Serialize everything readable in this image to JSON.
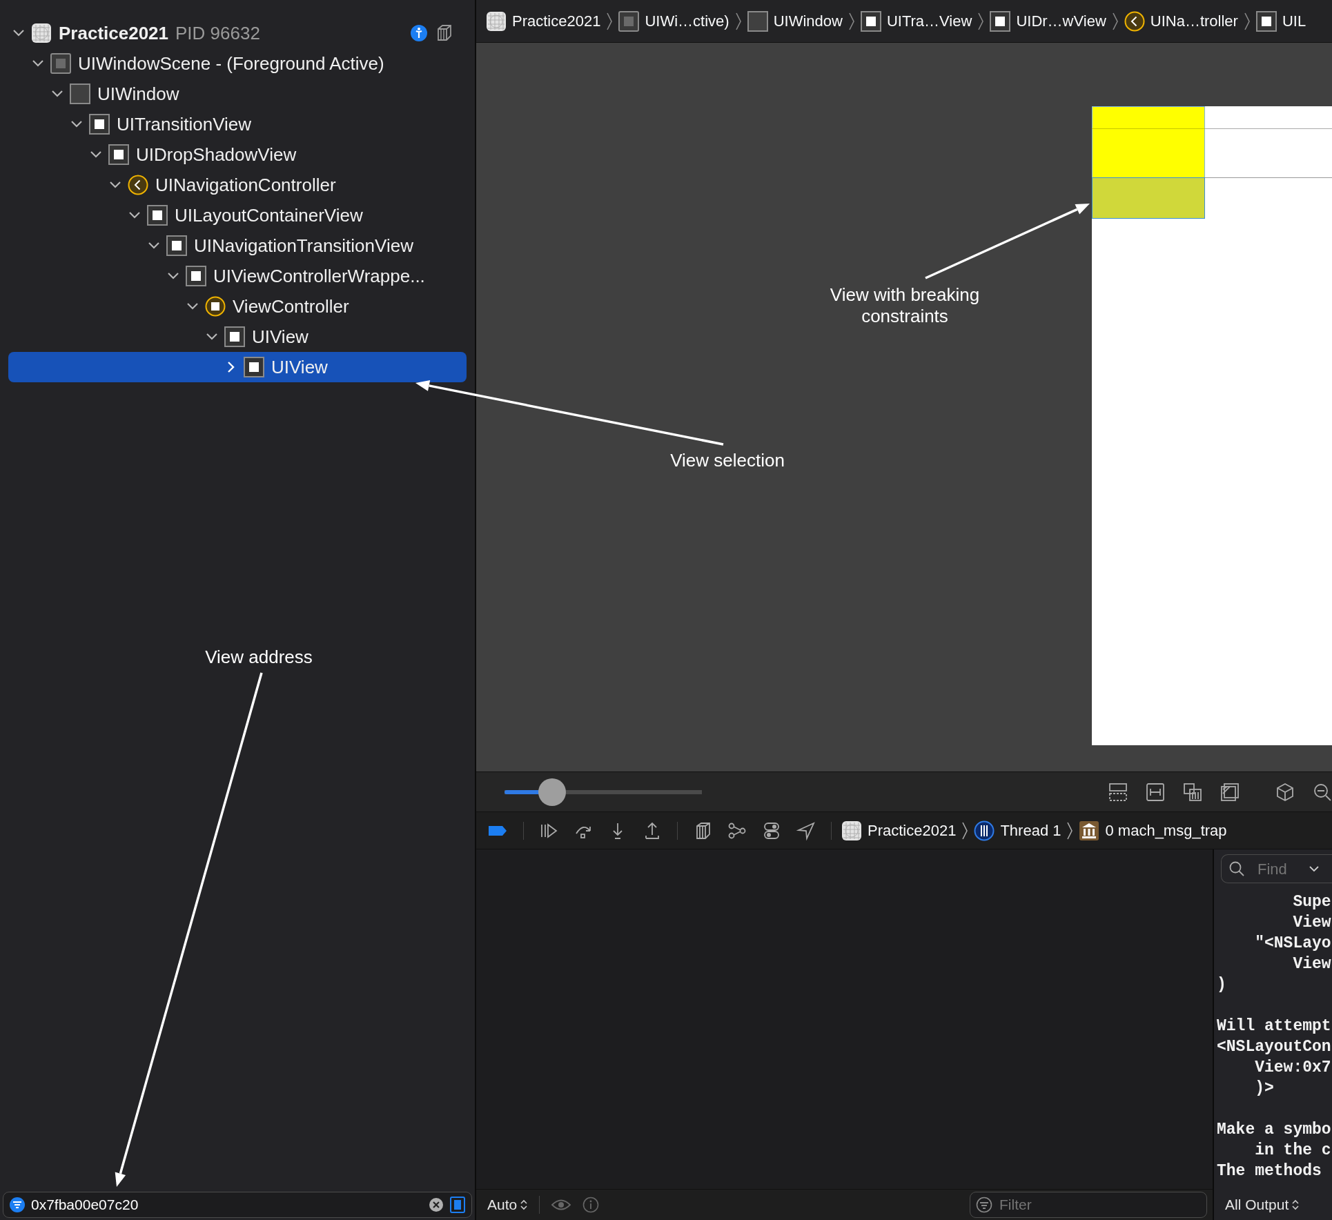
{
  "breadcrumb": [
    {
      "label": "Practice2021",
      "kind": "app"
    },
    {
      "label": "UIWi…ctive)",
      "kind": "scene"
    },
    {
      "label": "UIWindow",
      "kind": "window"
    },
    {
      "label": "UITra…View",
      "kind": "view"
    },
    {
      "label": "UIDr…wView",
      "kind": "view"
    },
    {
      "label": "UINa…troller",
      "kind": "nav"
    },
    {
      "label": "UIL",
      "kind": "view"
    }
  ],
  "tree": [
    {
      "label": "Practice2021",
      "detail": "PID 96632",
      "kind": "app",
      "expanded": true,
      "selected": false,
      "children": [
        {
          "label": "UIWindowScene - (Foreground Active)",
          "kind": "scene",
          "expanded": true,
          "selected": false,
          "children": [
            {
              "label": "UIWindow",
              "kind": "window",
              "expanded": true,
              "selected": false,
              "children": [
                {
                  "label": "UITransitionView",
                  "kind": "view",
                  "expanded": true,
                  "selected": false,
                  "children": [
                    {
                      "label": "UIDropShadowView",
                      "kind": "view",
                      "expanded": true,
                      "selected": false,
                      "children": [
                        {
                          "label": "UINavigationController",
                          "kind": "nav",
                          "expanded": true,
                          "selected": false,
                          "children": [
                            {
                              "label": "UILayoutContainerView",
                              "kind": "view",
                              "expanded": true,
                              "selected": false,
                              "children": [
                                {
                                  "label": "UINavigationTransitionView",
                                  "kind": "view",
                                  "expanded": true,
                                  "selected": false,
                                  "children": [
                                    {
                                      "label": "UIViewControllerWrappe...",
                                      "kind": "view",
                                      "expanded": true,
                                      "selected": false,
                                      "children": [
                                        {
                                          "label": "ViewController",
                                          "kind": "vc",
                                          "expanded": true,
                                          "selected": false,
                                          "children": [
                                            {
                                              "label": "UIView",
                                              "kind": "view",
                                              "expanded": true,
                                              "selected": false,
                                              "children": [
                                                {
                                                  "label": "UIView",
                                                  "kind": "view",
                                                  "expanded": false,
                                                  "selected": true
                                                }
                                              ]
                                            }
                                          ]
                                        }
                                      ]
                                    }
                                  ]
                                }
                              ]
                            }
                          ]
                        }
                      ]
                    }
                  ]
                }
              ]
            }
          ]
        }
      ]
    }
  ],
  "canvas": {
    "zoom_slider": {
      "level": 0.24
    }
  },
  "annotations": [
    {
      "text": "View with breaking constraints"
    },
    {
      "text": "View selection"
    },
    {
      "text": "View address"
    }
  ],
  "debug_bar": {
    "breakpoints_active": true,
    "breadcrumb": [
      {
        "label": "Practice2021",
        "kind": "app"
      },
      {
        "label": "Thread 1",
        "kind": "thread"
      },
      {
        "label": "0 mach_msg_trap",
        "kind": "frame"
      }
    ]
  },
  "console": {
    "find": {
      "placeholder": "Find"
    },
    "blocks": [
      [
        "        Supe",
        "        View",
        "    \"<NSLayo",
        "        View",
        ")"
      ],
      [
        "Will attempt",
        "<NSLayoutCon",
        "    View:0x7",
        "    )>"
      ],
      [
        "Make a symbo",
        "    in the c",
        "The methods"
      ]
    ],
    "output_filter": "All Output"
  },
  "bottom_bar": {
    "address_filter": {
      "value": "0x7fba00e07c20"
    },
    "mode": "Auto",
    "filter": {
      "placeholder": "Filter"
    }
  }
}
